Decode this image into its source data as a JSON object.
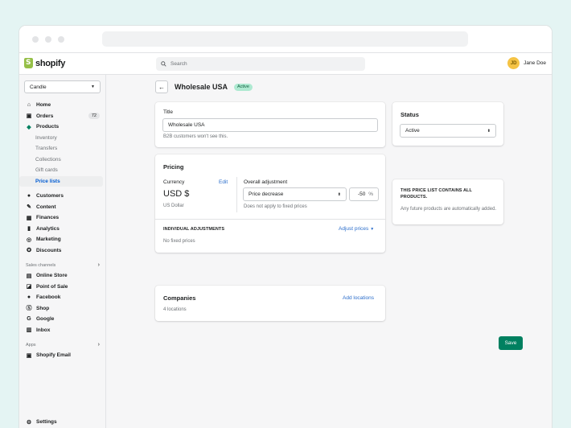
{
  "app": {
    "name": "shopify"
  },
  "search": {
    "placeholder": "Search"
  },
  "user": {
    "initials": "JD",
    "name": "Jane Doe"
  },
  "sidebar": {
    "store": "Candle",
    "items": [
      {
        "label": "Home",
        "icon": "home-icon"
      },
      {
        "label": "Orders",
        "icon": "orders-icon",
        "badge": "72"
      },
      {
        "label": "Products",
        "icon": "tag-icon"
      }
    ],
    "product_sub": [
      "Inventory",
      "Transfers",
      "Collections",
      "Gift cards",
      "Price lists"
    ],
    "items2": [
      {
        "label": "Customers",
        "icon": "customers-icon"
      },
      {
        "label": "Content",
        "icon": "content-icon"
      },
      {
        "label": "Finances",
        "icon": "bank-icon"
      },
      {
        "label": "Analytics",
        "icon": "analytics-icon"
      },
      {
        "label": "Marketing",
        "icon": "marketing-icon"
      },
      {
        "label": "Discounts",
        "icon": "discount-icon"
      }
    ],
    "sales_channels_label": "Sales channels",
    "channels": [
      {
        "label": "Online Store",
        "icon": "store-icon"
      },
      {
        "label": "Point of Sale",
        "icon": "pos-icon"
      },
      {
        "label": "Facebook",
        "icon": "facebook-icon"
      },
      {
        "label": "Shop",
        "icon": "shop-icon"
      },
      {
        "label": "Google",
        "icon": "google-icon"
      },
      {
        "label": "Inbox",
        "icon": "inbox-icon"
      }
    ],
    "apps_label": "Apps",
    "apps": [
      {
        "label": "Shopify Email",
        "icon": "email-icon"
      }
    ],
    "settings": "Settings"
  },
  "page": {
    "title": "Wholesale USA",
    "status": "Active"
  },
  "title_card": {
    "label": "Title",
    "value": "Wholesale USA",
    "help": "B2B customers won't see this."
  },
  "pricing": {
    "heading": "Pricing",
    "currency_label": "Currency",
    "edit": "Edit",
    "currency": "USD $",
    "currency_name": "US Dollar",
    "adjustment_label": "Overall adjustment",
    "adjustment_type": "Price decrease",
    "adjustment_value": "-50",
    "adjustment_unit": "%",
    "adjustment_help": "Does not apply to fixed prices",
    "individual_heading": "INDIVIDUAL ADJUSTMENTS",
    "adjust_prices": "Adjust prices",
    "no_fixed": "No fixed prices"
  },
  "companies": {
    "heading": "Companies",
    "add": "Add locations",
    "count": "4 locations"
  },
  "status_card": {
    "heading": "Status",
    "value": "Active"
  },
  "info_card": {
    "heading": "THIS PRICE LIST CONTAINS ALL PRODUCTS.",
    "text": "Any future products are automatically added."
  },
  "save": "Save",
  "colors": {
    "accent": "#008060",
    "link": "#2c6ecb",
    "active_pill": "#aee9d1"
  }
}
